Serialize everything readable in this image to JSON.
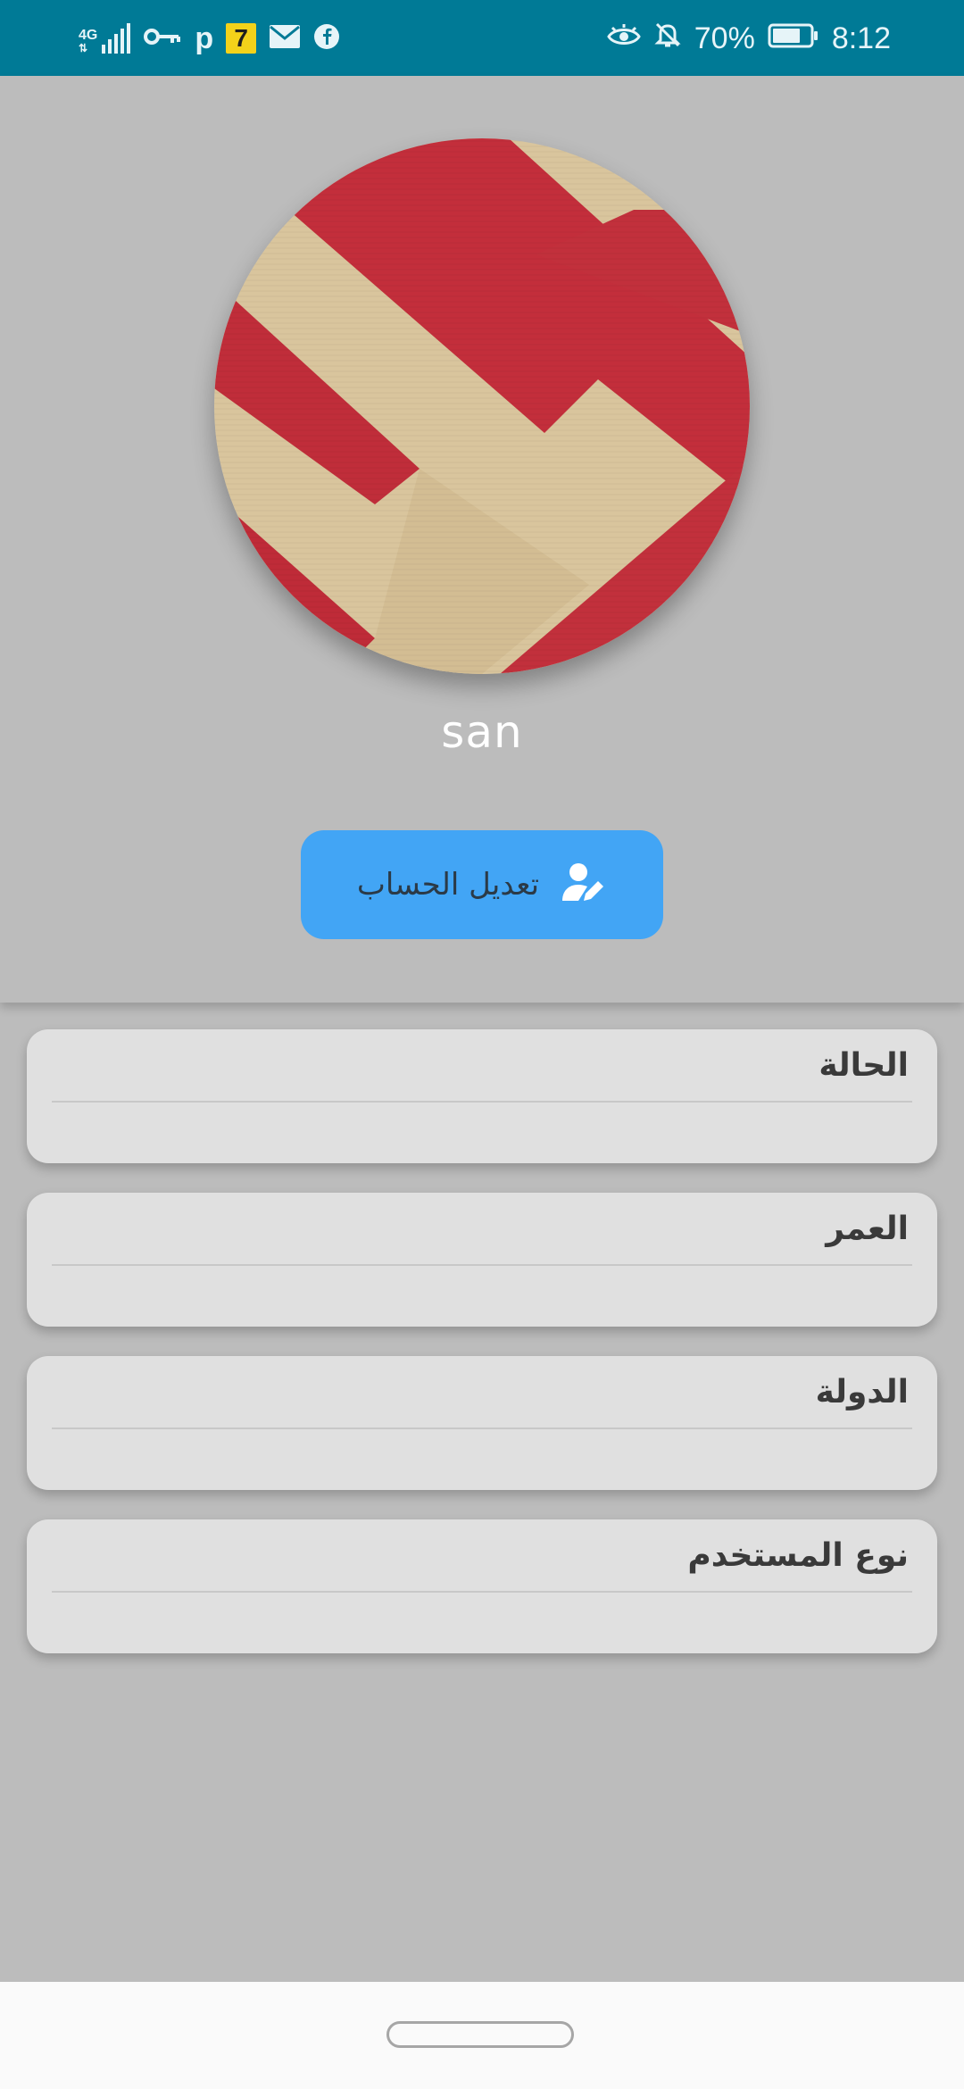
{
  "status_bar": {
    "network_label": "4G",
    "notification_badge": "7",
    "battery_percent": "70%",
    "time": "8:12",
    "bar_color": "#007a96",
    "icons": [
      "signal-icon",
      "vpn-key-icon",
      "parking-icon",
      "app-7-icon",
      "mail-icon",
      "facebook-icon",
      "eye-comfort-icon",
      "mute-icon",
      "battery-icon"
    ]
  },
  "profile": {
    "username": "san",
    "avatar_icon": "profile-photo",
    "edit_button": {
      "label": "تعديل الحساب",
      "icon": "edit-user-icon",
      "color": "#42a5f5"
    }
  },
  "info_cards": [
    {
      "title": "الحالة",
      "value": ""
    },
    {
      "title": "العمر",
      "value": ""
    },
    {
      "title": "الدولة",
      "value": ""
    },
    {
      "title": "نوع المستخدم",
      "value": ""
    }
  ],
  "colors": {
    "background": "#bcbcbc",
    "card": "#e0e0e0"
  }
}
